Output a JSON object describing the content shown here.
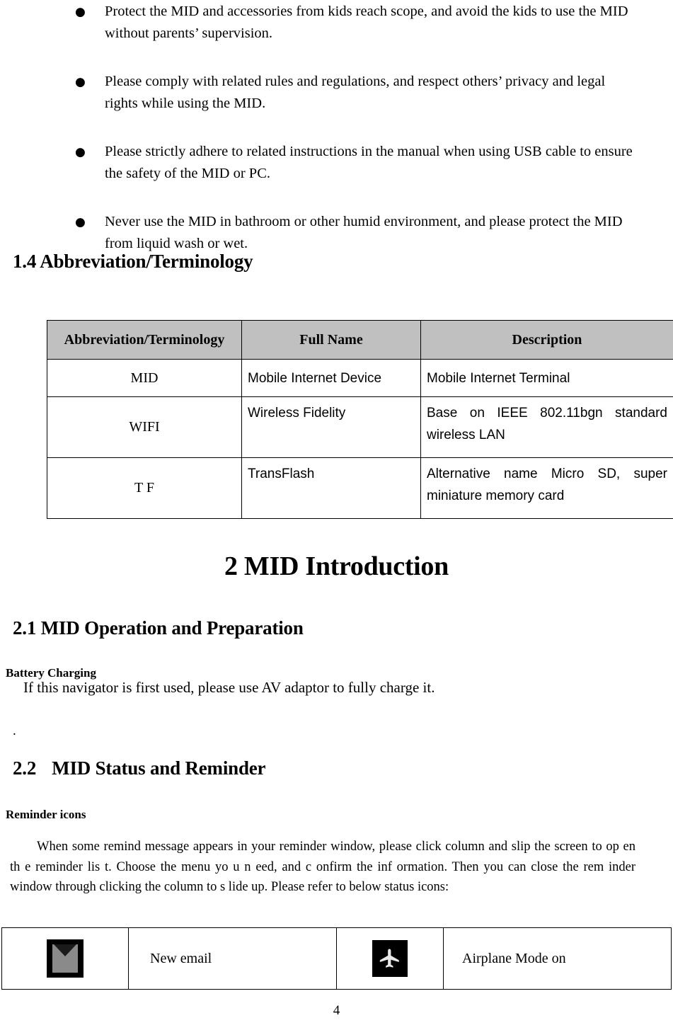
{
  "safety_bullets": [
    "Protect the MID and accessories from kids reach scope, and avoid the kids to use the MID without parents’ supervision.",
    "Please comply with related rules and regulations, and respect others’ privacy and legal rights while using the MID.",
    "Please strictly adhere to related instructions in the manual when using USB cable to ensure the safety of the MID or PC.",
    "Never use the MID in bathroom or other humid environment, and please protect the MID from liquid wash or wet."
  ],
  "bullet_glyph": "●",
  "headings": {
    "section_1_4": "1.4 Abbreviation/Terminology",
    "chapter_2": "2 MID Introduction",
    "section_2_1": "2.1 MID Operation and Preparation",
    "section_2_2_number": "2.2",
    "section_2_2_title": "MID Status and Reminder"
  },
  "abbr_table": {
    "headers": [
      "Abbreviation/Terminology",
      "Full Name",
      "Description"
    ],
    "rows": [
      {
        "abbr": "MID",
        "full_name": "Mobile Internet Device",
        "description": "Mobile Internet Terminal"
      },
      {
        "abbr": "WIFI",
        "full_name": "Wireless Fidelity",
        "description": "Base on IEEE 802.11bgn standard wireless LAN"
      },
      {
        "abbr": "T F",
        "full_name": "TransFlash",
        "description": "Alternative name Micro SD, super miniature memory card"
      }
    ],
    "header_background": "#c0c0c0"
  },
  "battery": {
    "label": "Battery Charging",
    "text": "If this navigator is first used, please use AV adaptor to fully charge it.",
    "stray_mark": "."
  },
  "reminder": {
    "label": "Reminder icons",
    "paragraph": "When some remind message appears in your reminder window, please click column and slip the screen to op en th e reminder lis t. Choose the  menu yo u n eed,  and c onfirm the  inf ormation. Then you can close the rem inder window through clicking the column to s lide up. Please refer to below status icons:"
  },
  "status_table": {
    "rows": [
      {
        "icon_left": "email-icon",
        "label_left": "New email",
        "icon_right": "airplane-icon",
        "label_right": "Airplane Mode on"
      }
    ]
  },
  "page_number": "4"
}
